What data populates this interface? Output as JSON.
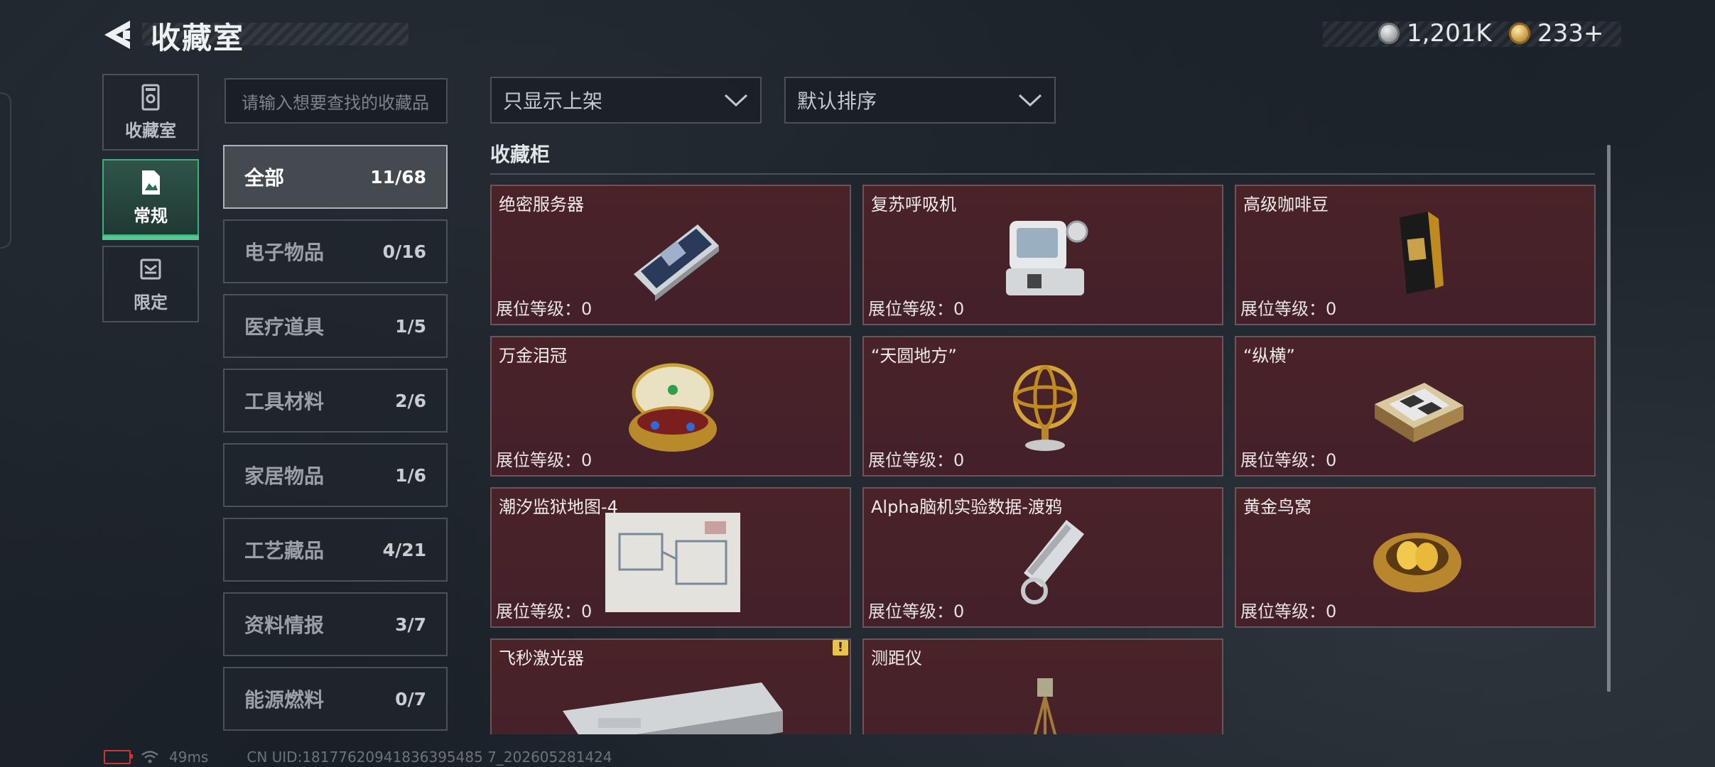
{
  "header": {
    "title": "收藏室",
    "currency": [
      {
        "icon": "silver-coin-icon",
        "value": "1,201K"
      },
      {
        "icon": "gold-coin-icon",
        "value": "233+"
      }
    ]
  },
  "nav": [
    {
      "label": "收藏室",
      "icon": "vault-icon",
      "active": false
    },
    {
      "label": "常规",
      "icon": "document-icon",
      "active": true
    },
    {
      "label": "限定",
      "icon": "limited-icon",
      "active": false
    }
  ],
  "search": {
    "placeholder": "请输入想要查找的收藏品"
  },
  "categories": [
    {
      "name": "全部",
      "count": "11/68",
      "active": true
    },
    {
      "name": "电子物品",
      "count": "0/16"
    },
    {
      "name": "医疗道具",
      "count": "1/5"
    },
    {
      "name": "工具材料",
      "count": "2/6"
    },
    {
      "name": "家居物品",
      "count": "1/6"
    },
    {
      "name": "工艺藏品",
      "count": "4/21"
    },
    {
      "name": "资料情报",
      "count": "3/7"
    },
    {
      "name": "能源燃料",
      "count": "0/7"
    }
  ],
  "filters": {
    "display": "只显示上架",
    "sort": "默认排序"
  },
  "section": {
    "title": "收藏柜"
  },
  "items": [
    {
      "name": "绝密服务器",
      "level": "展位等级：0",
      "art": "server"
    },
    {
      "name": "复苏呼吸机",
      "level": "展位等级：0",
      "art": "ventilator"
    },
    {
      "name": "高级咖啡豆",
      "level": "展位等级：0",
      "art": "coffee"
    },
    {
      "name": "万金泪冠",
      "level": "展位等级：0",
      "art": "egg"
    },
    {
      "name": "“天圆地方”",
      "level": "展位等级：0",
      "art": "armillary"
    },
    {
      "name": "“纵横”",
      "level": "展位等级：0",
      "art": "chess"
    },
    {
      "name": "潮汐监狱地图-4",
      "level": "展位等级：0",
      "art": "map"
    },
    {
      "name": "Alpha脑机实验数据-渡鸦",
      "level": "展位等级：0",
      "art": "drive"
    },
    {
      "name": "黄金鸟窝",
      "level": "展位等级：0",
      "art": "nest"
    },
    {
      "name": "飞秒激光器",
      "level": "",
      "art": "laser",
      "warning": "!"
    },
    {
      "name": "测距仪",
      "level": "",
      "art": "tripod"
    }
  ],
  "footer": {
    "ping": "49ms",
    "uid": "CN UID:18177620941836395485 7_202605281424"
  }
}
